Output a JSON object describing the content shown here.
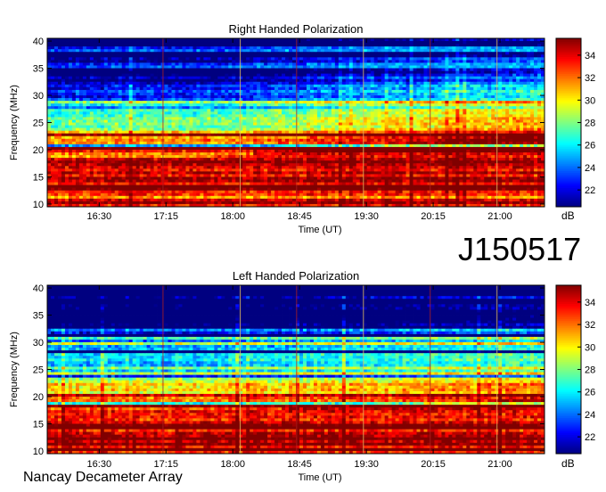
{
  "figure": {
    "observation_id": "J150517",
    "instrument": "Nancay Decameter Array"
  },
  "chart_data": [
    {
      "type": "heatmap",
      "title": "Right Handed Polarization",
      "xlabel": "Time (UT)",
      "ylabel": "Frequency (MHz)",
      "x_ticks": [
        "16:30",
        "17:15",
        "18:00",
        "18:45",
        "19:30",
        "20:15",
        "21:00"
      ],
      "x_tick_minutes": [
        990,
        1035,
        1080,
        1125,
        1170,
        1215,
        1260
      ],
      "x_range_minutes": [
        955,
        1290
      ],
      "y_ticks": [
        10,
        15,
        20,
        25,
        30,
        35,
        40
      ],
      "ylim": [
        9.5,
        40.5
      ],
      "colorbar": {
        "label": "dB",
        "ticks": [
          22,
          24,
          26,
          28,
          30,
          32,
          34
        ],
        "range": [
          20.5,
          35.5
        ]
      },
      "description": "Dynamic spectrum: intensity decreasing with frequency; strong emission below ~20 MHz, rising to ~25 MHz after 19:00 UT"
    },
    {
      "type": "heatmap",
      "title": "Left Handed Polarization",
      "xlabel": "Time (UT)",
      "ylabel": "Frequency (MHz)",
      "x_ticks": [
        "16:30",
        "17:15",
        "18:00",
        "18:45",
        "19:30",
        "20:15",
        "21:00"
      ],
      "x_tick_minutes": [
        990,
        1035,
        1080,
        1125,
        1170,
        1215,
        1260
      ],
      "x_range_minutes": [
        955,
        1290
      ],
      "y_ticks": [
        10,
        15,
        20,
        25,
        30,
        35,
        40
      ],
      "ylim": [
        9.5,
        40.5
      ],
      "colorbar": {
        "label": "dB",
        "ticks": [
          22,
          24,
          26,
          28,
          30,
          32,
          34
        ],
        "range": [
          20.5,
          35.5
        ]
      },
      "description": "Dynamic spectrum: strong emission below ~18 MHz, banded structure 20-30 MHz"
    }
  ]
}
